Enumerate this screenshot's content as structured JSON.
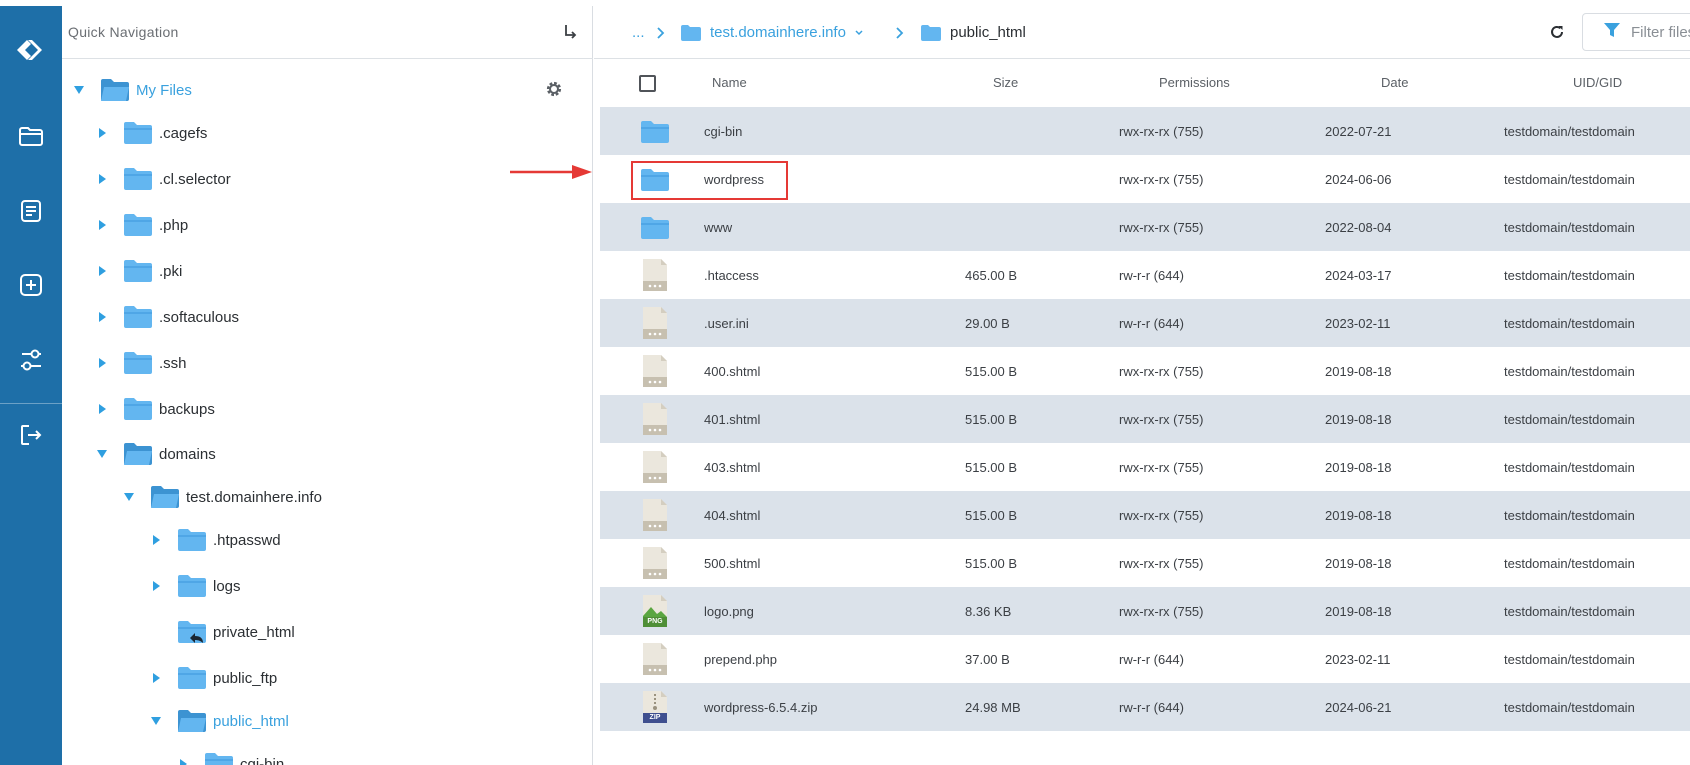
{
  "quick_nav": {
    "title": "Quick Navigation"
  },
  "tree": {
    "root": "My Files",
    "items": [
      {
        "label": ".cagefs"
      },
      {
        "label": ".cl.selector"
      },
      {
        "label": ".php"
      },
      {
        "label": ".pki"
      },
      {
        "label": ".softaculous"
      },
      {
        "label": ".ssh"
      },
      {
        "label": "backups"
      },
      {
        "label": "domains"
      },
      {
        "label": "test.domainhere.info"
      },
      {
        "label": ".htpasswd"
      },
      {
        "label": "logs"
      },
      {
        "label": "private_html"
      },
      {
        "label": "public_ftp"
      },
      {
        "label": "public_html"
      },
      {
        "label": "cgi-bin"
      }
    ]
  },
  "breadcrumb": {
    "ellipsis": "...",
    "domain": "test.domainhere.info",
    "current": "public_html"
  },
  "filter": {
    "placeholder": "Filter files"
  },
  "table": {
    "columns": [
      "Name",
      "Size",
      "Permissions",
      "Date",
      "UID/GID"
    ],
    "rows": [
      {
        "name": "cgi-bin",
        "size": "",
        "perm": "rwx-rx-rx (755)",
        "date": "2022-07-21",
        "uid": "testdomain/testdomain",
        "type": "folder"
      },
      {
        "name": "wordpress",
        "size": "",
        "perm": "rwx-rx-rx (755)",
        "date": "2024-06-06",
        "uid": "testdomain/testdomain",
        "type": "folder"
      },
      {
        "name": "www",
        "size": "",
        "perm": "rwx-rx-rx (755)",
        "date": "2022-08-04",
        "uid": "testdomain/testdomain",
        "type": "folder"
      },
      {
        "name": ".htaccess",
        "size": "465.00 B",
        "perm": "rw-r-r (644)",
        "date": "2024-03-17",
        "uid": "testdomain/testdomain",
        "type": "file"
      },
      {
        "name": ".user.ini",
        "size": "29.00 B",
        "perm": "rw-r-r (644)",
        "date": "2023-02-11",
        "uid": "testdomain/testdomain",
        "type": "file"
      },
      {
        "name": "400.shtml",
        "size": "515.00 B",
        "perm": "rwx-rx-rx (755)",
        "date": "2019-08-18",
        "uid": "testdomain/testdomain",
        "type": "file"
      },
      {
        "name": "401.shtml",
        "size": "515.00 B",
        "perm": "rwx-rx-rx (755)",
        "date": "2019-08-18",
        "uid": "testdomain/testdomain",
        "type": "file"
      },
      {
        "name": "403.shtml",
        "size": "515.00 B",
        "perm": "rwx-rx-rx (755)",
        "date": "2019-08-18",
        "uid": "testdomain/testdomain",
        "type": "file"
      },
      {
        "name": "404.shtml",
        "size": "515.00 B",
        "perm": "rwx-rx-rx (755)",
        "date": "2019-08-18",
        "uid": "testdomain/testdomain",
        "type": "file"
      },
      {
        "name": "500.shtml",
        "size": "515.00 B",
        "perm": "rwx-rx-rx (755)",
        "date": "2019-08-18",
        "uid": "testdomain/testdomain",
        "type": "file"
      },
      {
        "name": "logo.png",
        "size": "8.36 KB",
        "perm": "rwx-rx-rx (755)",
        "date": "2019-08-18",
        "uid": "testdomain/testdomain",
        "type": "png",
        "badge": "PNG"
      },
      {
        "name": "prepend.php",
        "size": "37.00 B",
        "perm": "rw-r-r (644)",
        "date": "2023-02-11",
        "uid": "testdomain/testdomain",
        "type": "file"
      },
      {
        "name": "wordpress-6.5.4.zip",
        "size": "24.98 MB",
        "perm": "rw-r-r (644)",
        "date": "2024-06-21",
        "uid": "testdomain/testdomain",
        "type": "zip",
        "badge": "ZIP"
      }
    ]
  },
  "colors": {
    "rail": "#1e6fa8",
    "accent": "#3aa1de",
    "folder": "#63b6f0",
    "row_alt": "#dbe2ea",
    "highlight": "#e53935"
  },
  "icons": [
    "logo-icon",
    "folder-open-icon",
    "document-icon",
    "add-box-icon",
    "settings-sliders-icon",
    "logout-icon",
    "gear-icon",
    "refresh-icon",
    "filter-icon"
  ]
}
